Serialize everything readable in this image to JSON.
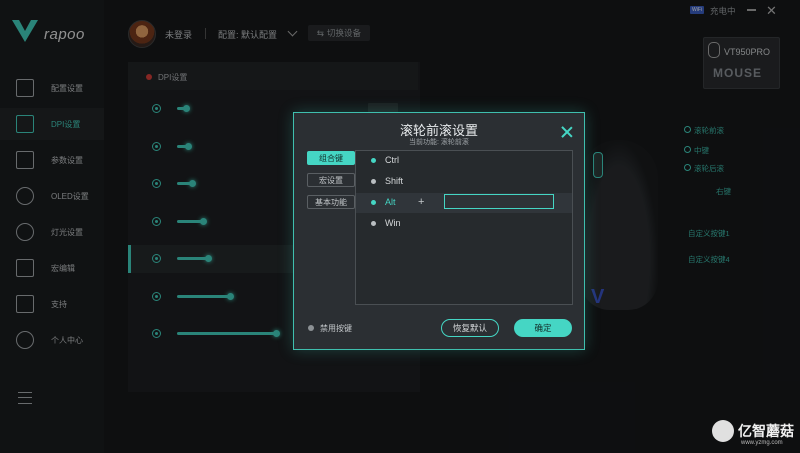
{
  "sidebar": {
    "logo_text": "rapoo",
    "items": [
      {
        "label": "配置设置",
        "icon": "config-icon",
        "active": false
      },
      {
        "label": "DPI设置",
        "icon": "dpi-icon",
        "active": true
      },
      {
        "label": "参数设置",
        "icon": "parameter-icon",
        "active": false
      },
      {
        "label": "OLED设置",
        "icon": "refresh-icon",
        "active": false
      },
      {
        "label": "灯光设置",
        "icon": "bulb-icon",
        "active": false
      },
      {
        "label": "宏编辑",
        "icon": "macro-icon",
        "active": false
      },
      {
        "label": "支持",
        "icon": "thumbs-up-icon",
        "active": false
      },
      {
        "label": "个人中心",
        "icon": "user-icon",
        "active": false
      }
    ]
  },
  "header": {
    "login_status": "未登录",
    "profile_label": "配置: 默认配置",
    "switch_device": "切换设备",
    "wifi_badge": "WiFi",
    "charging_status": "充电中"
  },
  "dpi_panel": {
    "title": "DPI设置",
    "rows": [
      {
        "level": 0.04
      },
      {
        "level": 0.05
      },
      {
        "level": 0.07
      },
      {
        "level": 0.12
      },
      {
        "level": 0.14
      },
      {
        "level": 0.24
      },
      {
        "level": 0.45
      }
    ],
    "selected_index": 4
  },
  "device": {
    "model": "VT950PRO",
    "type_label": "MOUSE",
    "callouts": [
      "滚轮前滚",
      "中键",
      "滚轮后滚",
      "右键",
      "自定义按键1",
      "自定义按键4"
    ]
  },
  "dialog": {
    "title": "滚轮前滚设置",
    "subtitle": "当前功能: 滚轮前滚",
    "tabs": [
      "组合键",
      "宏设置",
      "基本功能"
    ],
    "active_tab": 0,
    "keys": [
      {
        "label": "Ctrl",
        "on": true
      },
      {
        "label": "Shift",
        "on": false
      },
      {
        "label": "Alt",
        "on": true
      },
      {
        "label": "Win",
        "on": false
      }
    ],
    "plus_symbol": "+",
    "key_input_value": "",
    "disable_label": "禁用按键",
    "restore_label": "恢复默认",
    "ok_label": "确定"
  },
  "watermark": {
    "text": "亿智蘑菇",
    "url": "www.yzmg.com"
  },
  "colors": {
    "accent": "#45d6c4",
    "background": "#17191b",
    "dialog_bg": "#2b2f33"
  }
}
